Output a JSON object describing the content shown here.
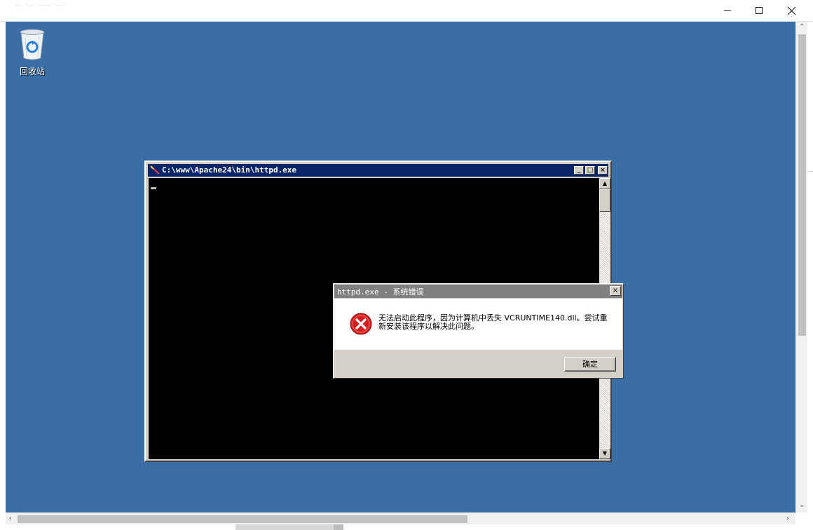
{
  "host_window": {
    "title": "··· ···· ···· ····",
    "buttons": {
      "minimize": "—",
      "maximize": "☐",
      "close": "✕"
    }
  },
  "desktop": {
    "background": "#3a6ea5",
    "icons": [
      {
        "label": "回收站",
        "icon": "recycle-bin-icon"
      }
    ]
  },
  "console": {
    "title": "C:\\www\\Apache24\\bin\\httpd.exe",
    "buttons": {
      "minimize": "_",
      "maximize": "□",
      "close": "×"
    },
    "scroll": {
      "up": "▲",
      "down": "▼"
    }
  },
  "dialog": {
    "title": "httpd.exe - 系统错误",
    "close": "×",
    "message": "无法启动此程序，因为计算机中丢失 VCRUNTIME140.dll。尝试重新安装该程序以解决此问题。",
    "ok_button": "确定",
    "icon": "error-icon"
  },
  "scrollbars": {
    "v_up": "⌃",
    "v_down": "⌄",
    "h_left": "‹",
    "h_right": "›"
  }
}
